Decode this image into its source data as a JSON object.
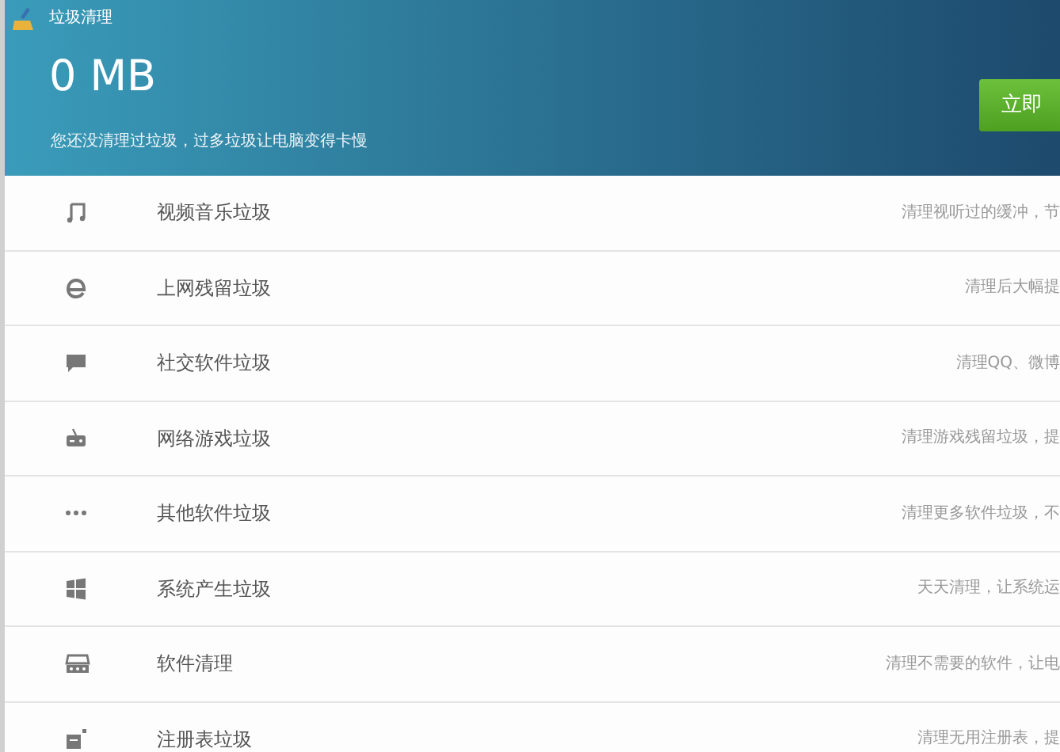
{
  "window": {
    "title": "垃圾清理"
  },
  "header": {
    "size": "0 MB",
    "hint": "您还没清理过垃圾，过多垃圾让电脑变得卡慢",
    "button": "立即"
  },
  "items": [
    {
      "kind": "music",
      "label": "视频音乐垃圾",
      "description": "清理视听过的缓冲，节"
    },
    {
      "kind": "browser",
      "label": "上网残留垃圾",
      "description": "清理后大幅提"
    },
    {
      "kind": "chat",
      "label": "社交软件垃圾",
      "description": "清理QQ、微博"
    },
    {
      "kind": "game",
      "label": "网络游戏垃圾",
      "description": "清理游戏残留垃圾，提"
    },
    {
      "kind": "dots",
      "label": "其他软件垃圾",
      "description": "清理更多软件垃圾，不"
    },
    {
      "kind": "windows",
      "label": "系统产生垃圾",
      "description": "天天清理，让系统运"
    },
    {
      "kind": "software",
      "label": "软件清理",
      "description": "清理不需要的软件，让电"
    },
    {
      "kind": "registry",
      "label": "注册表垃圾",
      "description": "清理无用注册表，提"
    }
  ]
}
